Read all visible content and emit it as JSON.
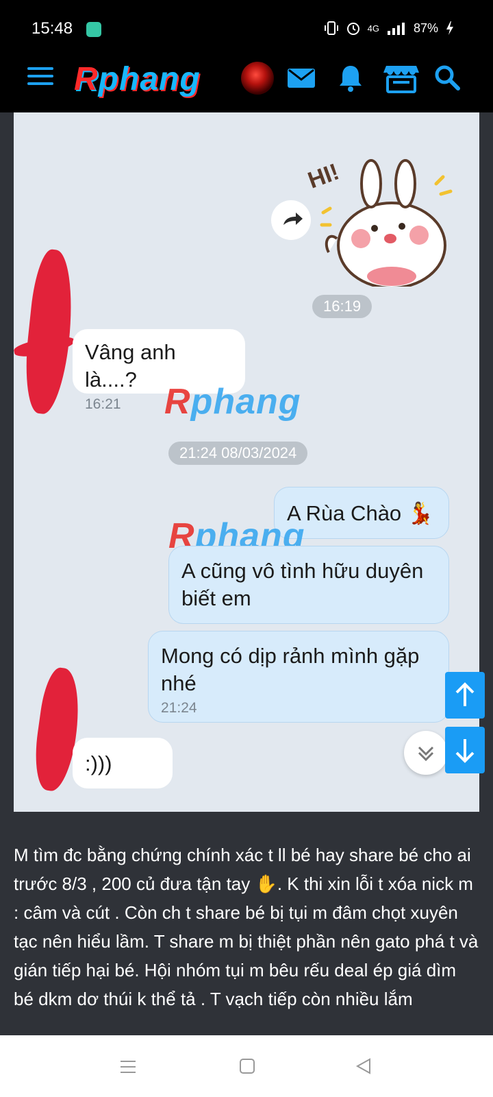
{
  "status_bar": {
    "time": "15:48",
    "network": "4G",
    "battery": "87%"
  },
  "app_bar": {
    "logo": "Rphang",
    "icons": [
      "menu-icon",
      "avatar",
      "mail-icon",
      "bell-icon",
      "store-icon",
      "search-icon"
    ],
    "accent_color": "#1da1f2"
  },
  "chat": {
    "sticker_text": "HI!",
    "time_1": "16:19",
    "incoming_1": {
      "text": "Vâng anh là....?",
      "time": "16:21"
    },
    "date_pill": "21:24 08/03/2024",
    "outgoing": [
      {
        "text": "A Rùa Chào 💃"
      },
      {
        "text": "A cũng vô tình hữu duyên biết em"
      },
      {
        "text": "Mong có dịp rảnh mình gặp nhé",
        "time": "21:24"
      }
    ],
    "incoming_2": {
      "text": ":)))"
    },
    "watermark": "Rphang"
  },
  "post": {
    "text": "M tìm đc bằng chứng chính xác t ll bé hay share bé cho ai trước 8/3 , 200 củ đưa tận tay ✋. K thi xin lỗi t xóa nick m : câm và cút . Còn ch t share bé bị tụi m đâm chọt xuyên tạc nên hiểu lầm. T share m bị thiệt phần nên gato phá t và gián tiếp hại bé. Hội nhóm tụi m bêu rếu deal ép giá dìm bé dkm dơ thúi k thể tả . T vạch tiếp còn nhiều lắm"
  }
}
